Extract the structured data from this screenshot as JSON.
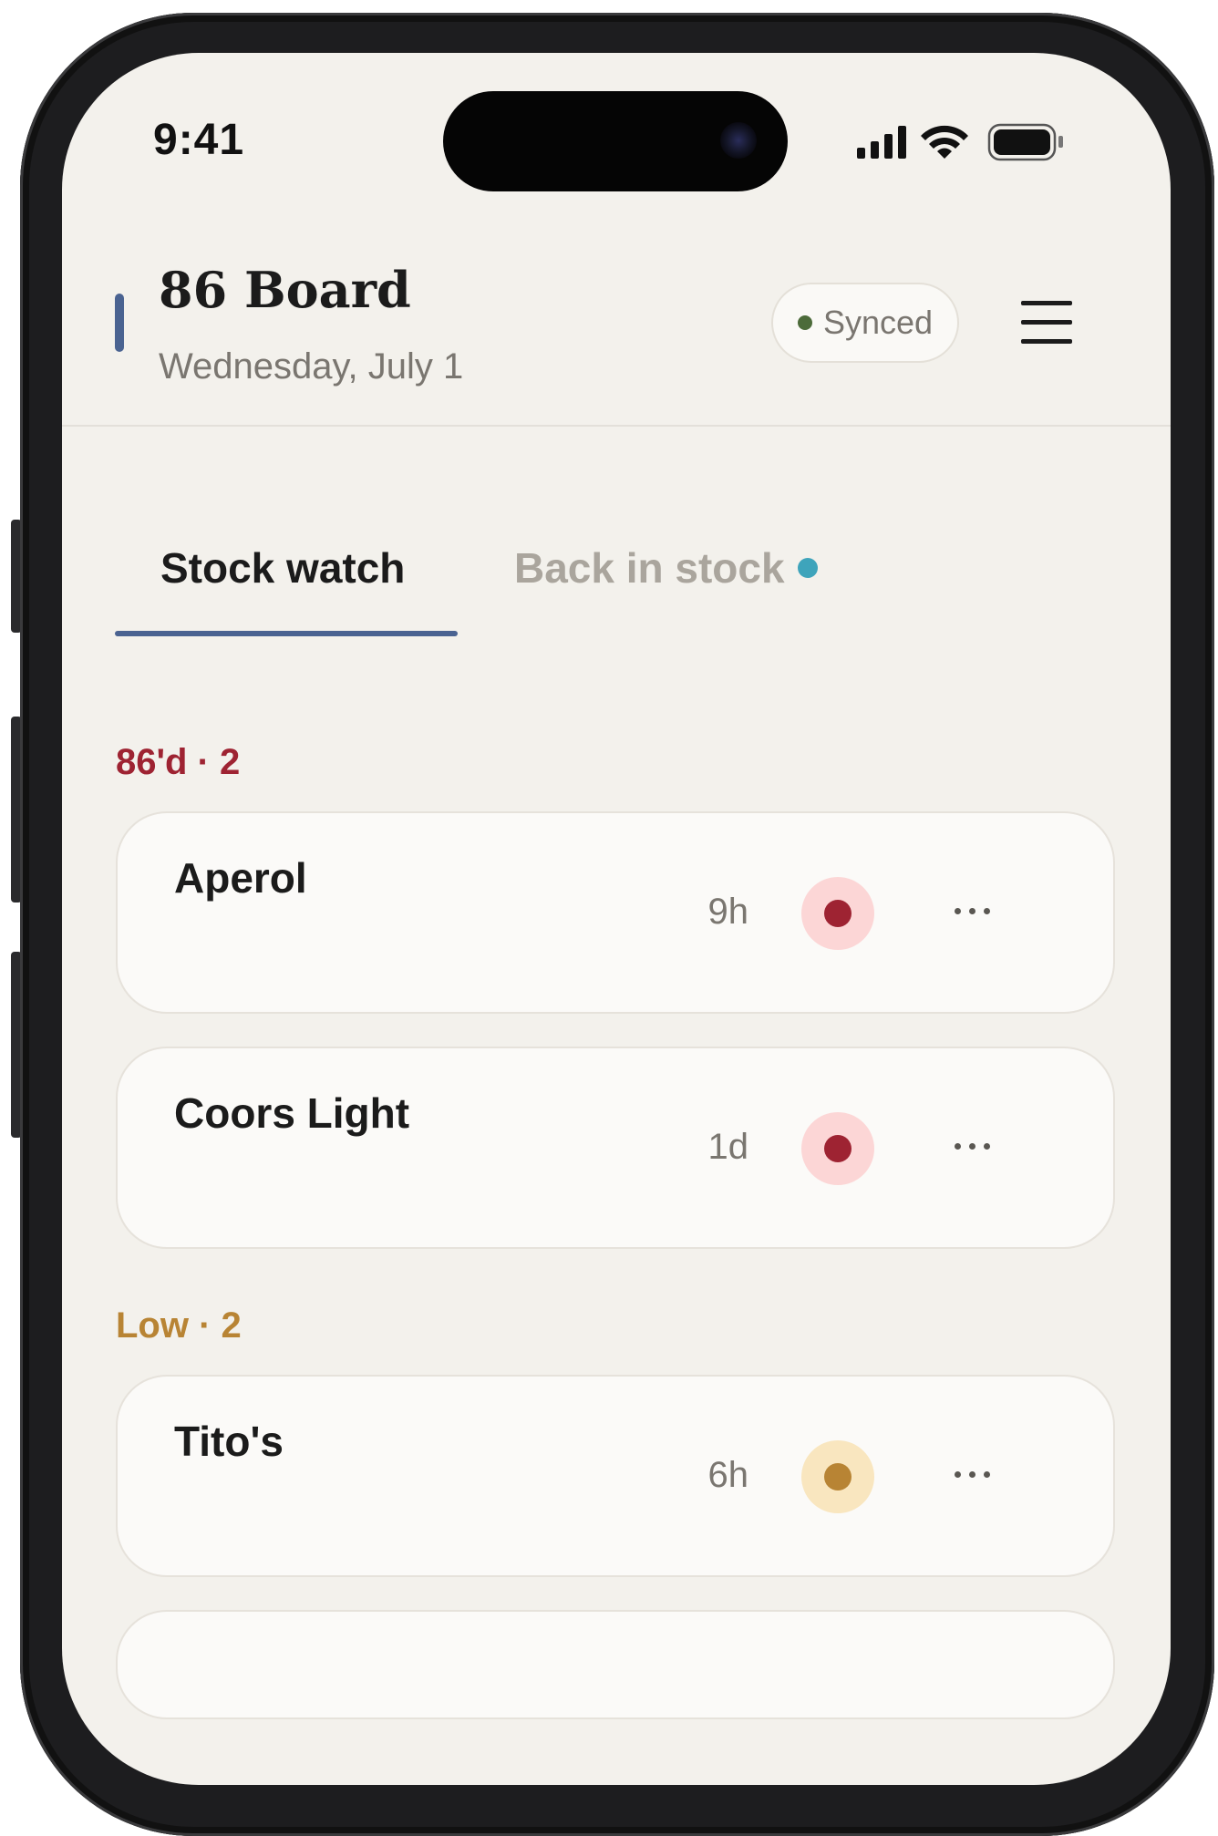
{
  "status_bar": {
    "time": "9:41"
  },
  "header": {
    "title": "86 Board",
    "date": "Wednesday, July 1",
    "sync_label": "Synced"
  },
  "tabs": [
    {
      "label": "Stock watch",
      "active": true
    },
    {
      "label": "Back in stock",
      "active": false,
      "has_badge": true
    }
  ],
  "sections": [
    {
      "label": "86'd · 2",
      "color": "#9e2332",
      "items": [
        {
          "name": "Aperol",
          "age": "9h",
          "status": "out"
        },
        {
          "name": "Coors Light",
          "age": "1d",
          "status": "out"
        }
      ]
    },
    {
      "label": "Low · 2",
      "color": "#b88434",
      "items": [
        {
          "name": "Tito's",
          "age": "6h",
          "status": "low"
        }
      ]
    }
  ],
  "colors": {
    "accent": "#4a6391",
    "out": "#9e2332",
    "out_bg": "#fcd6d6",
    "low": "#b88434",
    "low_bg": "#f9e6bf",
    "synced": "#4c6b3a",
    "badge": "#3ea4bb"
  }
}
